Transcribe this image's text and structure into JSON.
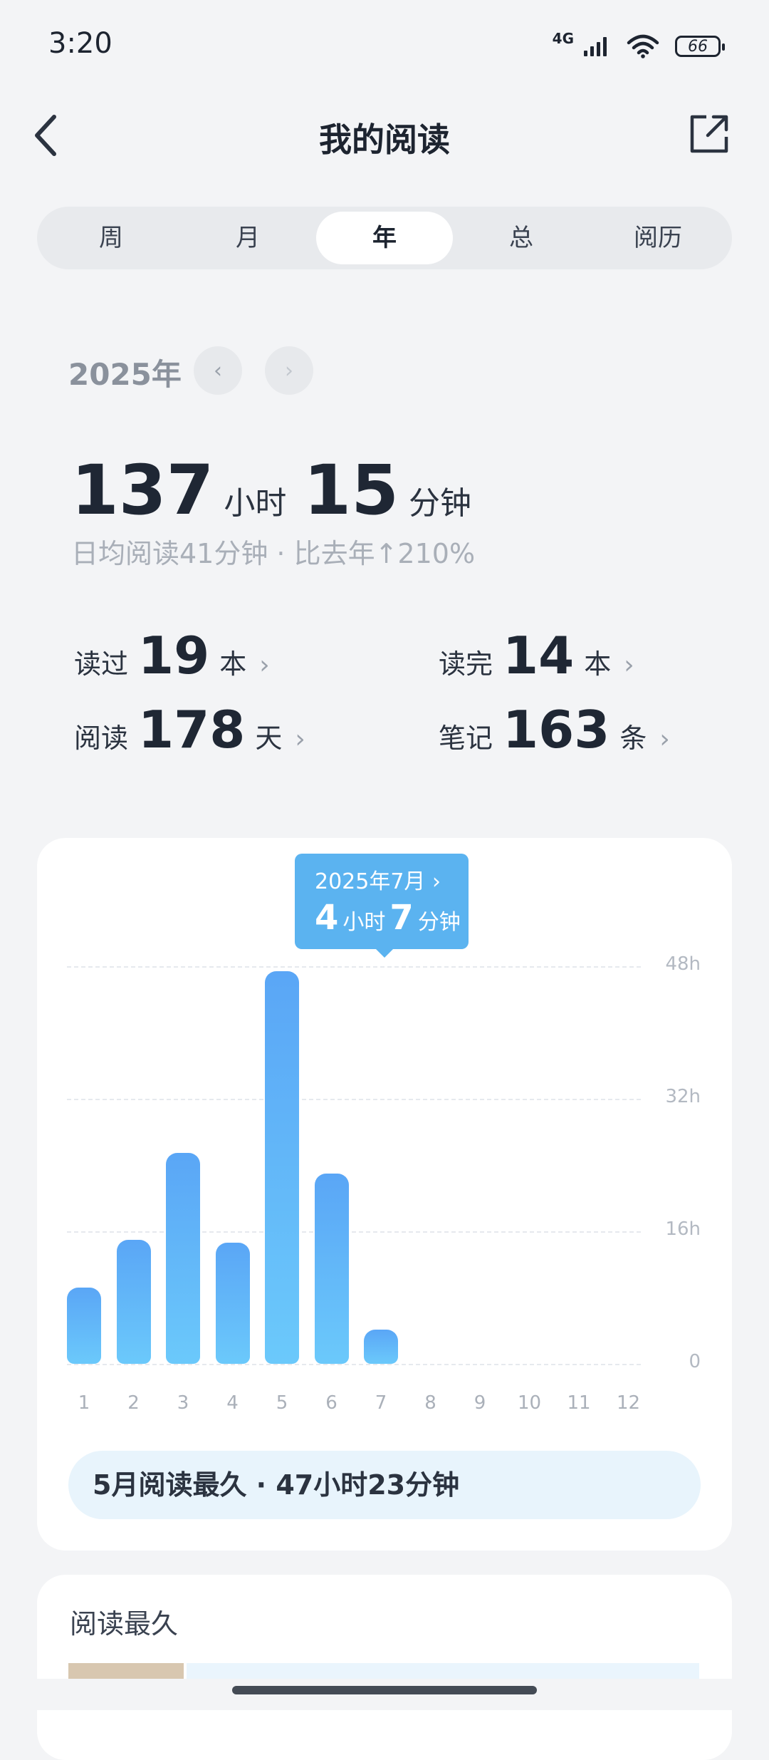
{
  "status_bar": {
    "time": "3:20",
    "network": "4G",
    "battery": "66"
  },
  "header": {
    "title": "我的阅读"
  },
  "tabs": [
    {
      "label": "周"
    },
    {
      "label": "月"
    },
    {
      "label": "年",
      "active": true
    },
    {
      "label": "总"
    },
    {
      "label": "阅历"
    }
  ],
  "year_selector": {
    "year": "2025年",
    "prev": "‹",
    "next": "›"
  },
  "totals": {
    "hours": "137",
    "hours_unit": "小时",
    "minutes": "15",
    "minutes_unit": "分钟",
    "subline": "日均阅读41分钟 · 比去年↑210%"
  },
  "stats": [
    {
      "label": "读过",
      "value": "19",
      "unit": "本"
    },
    {
      "label": "读完",
      "value": "14",
      "unit": "本"
    },
    {
      "label": "阅读",
      "value": "178",
      "unit": "天"
    },
    {
      "label": "笔记",
      "value": "163",
      "unit": "条"
    }
  ],
  "tooltip": {
    "date": "2025年7月 ›",
    "hours": "4",
    "hours_unit": "小时",
    "minutes": "7",
    "minutes_unit": "分钟"
  },
  "chart_data": {
    "type": "bar",
    "categories": [
      "1",
      "2",
      "3",
      "4",
      "5",
      "6",
      "7",
      "8",
      "9",
      "10",
      "11",
      "12"
    ],
    "values": [
      9.2,
      15.0,
      25.5,
      14.6,
      47.4,
      23.0,
      4.1,
      0,
      0,
      0,
      0,
      0
    ],
    "y_ticks": [
      "0",
      "16h",
      "32h",
      "48h"
    ],
    "ylim": [
      0,
      48
    ],
    "bar_color": "#5aa6f6"
  },
  "summary": "5月阅读最久 · 47小时23分钟",
  "section2": {
    "title": "阅读最久"
  }
}
